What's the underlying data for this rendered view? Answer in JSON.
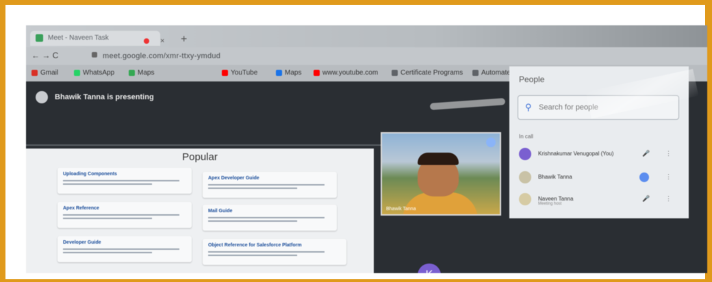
{
  "browser": {
    "tab_title": "Meet - Naveen Task",
    "url": "meet.google.com/xmr-ttxy-ymdud",
    "nav_label": "← → C",
    "new_tab": "+",
    "close_tab": "×",
    "bookmarks": [
      {
        "label": "Gmail",
        "color": "#d93025"
      },
      {
        "label": "WhatsApp",
        "color": "#25d366"
      },
      {
        "label": "Maps",
        "color": "#34a853"
      },
      {
        "label": "YouTube",
        "color": "#ff0000"
      },
      {
        "label": "Maps",
        "color": "#1a73e8"
      },
      {
        "label": "www.youtube.com",
        "color": "#ff0000"
      },
      {
        "label": "Certificate Programs",
        "color": "#5f6368"
      },
      {
        "label": "Automate Testing",
        "color": "#5f6368"
      }
    ]
  },
  "meet": {
    "presenting_text": "Bhawik Tanna is presenting",
    "slide": {
      "heading": "Popular",
      "cards": [
        {
          "title": "Uploading Components"
        },
        {
          "title": "Apex Developer Guide"
        },
        {
          "title": "Apex Reference"
        },
        {
          "title": "Mail Guide"
        },
        {
          "title": "Developer Guide"
        },
        {
          "title": "Object Reference for Salesforce Platform"
        }
      ]
    },
    "video_tile": {
      "name": "Bhawik Tanna"
    },
    "self_avatar_initial": "K"
  },
  "people_panel": {
    "title": "People",
    "search_placeholder": "Search for people",
    "section_label": "In call",
    "participants": [
      {
        "name": "Krishnakumar Venugopal (You)",
        "sub": "",
        "avatar_color": "#7a5fd0"
      },
      {
        "name": "Bhawik Tanna",
        "sub": "",
        "avatar_color": "#c9c2a6"
      },
      {
        "name": "Naveen Tanna",
        "sub": "Meeting host",
        "avatar_color": "#d6cba4"
      }
    ]
  }
}
